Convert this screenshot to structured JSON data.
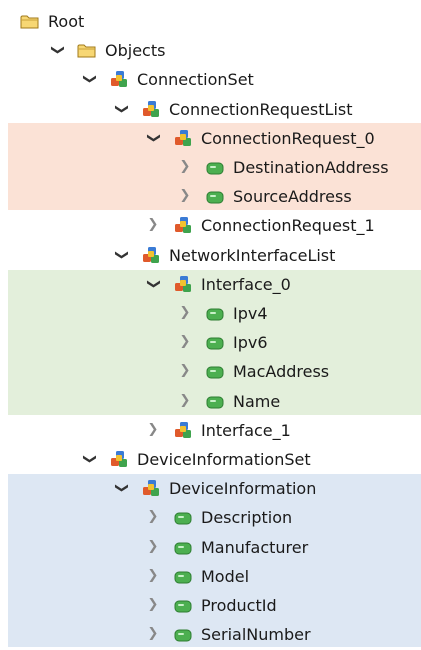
{
  "colors": {
    "highlight_connection_request": "#fbe2d6",
    "highlight_interface": "#e3efdb",
    "highlight_device_information": "#dde7f3",
    "variable_icon_fill": "#4caf50",
    "folder_icon_fill": "#f7d774"
  },
  "tree": [
    {
      "label": "Root",
      "level": 0,
      "icon": "folder-icon",
      "expander": "none"
    },
    {
      "label": "Objects",
      "level": 1,
      "icon": "folder-icon",
      "expander": "expanded"
    },
    {
      "label": "ConnectionSet",
      "level": 2,
      "icon": "object-icon",
      "expander": "expanded"
    },
    {
      "label": "ConnectionRequestList",
      "level": 3,
      "icon": "object-icon",
      "expander": "expanded"
    },
    {
      "label": "ConnectionRequest_0",
      "level": 4,
      "icon": "object-icon",
      "expander": "expanded"
    },
    {
      "label": "DestinationAddress",
      "level": 5,
      "icon": "variable-icon",
      "expander": "collapsed"
    },
    {
      "label": "SourceAddress",
      "level": 5,
      "icon": "variable-icon",
      "expander": "collapsed"
    },
    {
      "label": "ConnectionRequest_1",
      "level": 4,
      "icon": "object-icon",
      "expander": "collapsed"
    },
    {
      "label": "NetworkInterfaceList",
      "level": 3,
      "icon": "object-icon",
      "expander": "expanded"
    },
    {
      "label": "Interface_0",
      "level": 4,
      "icon": "object-icon",
      "expander": "expanded"
    },
    {
      "label": "Ipv4",
      "level": 5,
      "icon": "variable-icon",
      "expander": "collapsed"
    },
    {
      "label": "Ipv6",
      "level": 5,
      "icon": "variable-icon",
      "expander": "collapsed"
    },
    {
      "label": "MacAddress",
      "level": 5,
      "icon": "variable-icon",
      "expander": "collapsed"
    },
    {
      "label": "Name",
      "level": 5,
      "icon": "variable-icon",
      "expander": "collapsed"
    },
    {
      "label": "Interface_1",
      "level": 4,
      "icon": "object-icon",
      "expander": "collapsed"
    },
    {
      "label": "DeviceInformationSet",
      "level": 2,
      "icon": "object-icon",
      "expander": "expanded"
    },
    {
      "label": "DeviceInformation",
      "level": 3,
      "icon": "object-icon",
      "expander": "expanded"
    },
    {
      "label": "Description",
      "level": 4,
      "icon": "variable-icon",
      "expander": "collapsed"
    },
    {
      "label": "Manufacturer",
      "level": 4,
      "icon": "variable-icon",
      "expander": "collapsed"
    },
    {
      "label": "Model",
      "level": 4,
      "icon": "variable-icon",
      "expander": "collapsed"
    },
    {
      "label": "ProductId",
      "level": 4,
      "icon": "variable-icon",
      "expander": "collapsed"
    },
    {
      "label": "SerialNumber",
      "level": 4,
      "icon": "variable-icon",
      "expander": "collapsed"
    }
  ]
}
